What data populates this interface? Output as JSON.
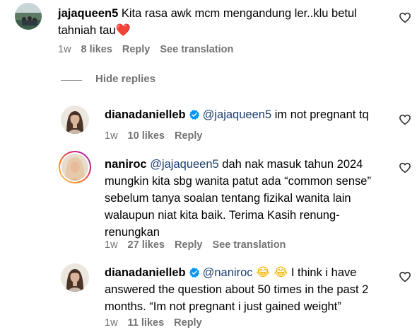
{
  "comments": [
    {
      "username": "jajaqueen5",
      "text": "Kita rasa awk mcm mengandung ler..klu betul tahniah tau",
      "emoji": "❤️",
      "time": "1w",
      "likes": "8 likes",
      "reply": "Reply",
      "translate": "See translation"
    }
  ],
  "hide_replies": "Hide replies",
  "replies": [
    {
      "username": "dianadanielleb",
      "mention": "@jajaqueen5",
      "text": "im not pregnant tq",
      "time": "1w",
      "likes": "10 likes",
      "reply": "Reply"
    },
    {
      "username": "naniroc",
      "mention": "@jajaqueen5",
      "text": "dah nak masuk tahun 2024 mungkin kita sbg wanita patut ada “common sense” sebelum tanya soalan tentang fizikal wanita lain walaupun niat kita baik. Terima Kasih renung-renungkan",
      "time": "1w",
      "likes": "27 likes",
      "reply": "Reply",
      "translate": "See translation"
    },
    {
      "username": "dianadanielleb",
      "mention": "@naniroc",
      "emoji": "😂 😂",
      "text": "I think i have answered the question about 50 times in the past 2 months. “Im not pregnant i just gained weight”",
      "time": "1w",
      "likes": "11 likes",
      "reply": "Reply"
    }
  ],
  "icons": {
    "like": "heart-outline-icon",
    "verified": "verified-badge-icon"
  },
  "colors": {
    "mention": "#1b3e6e",
    "meta": "#737373",
    "verified": "#0095f6",
    "story_ring": [
      "#feda75",
      "#fa7e1e",
      "#d62976",
      "#962fbf"
    ]
  }
}
